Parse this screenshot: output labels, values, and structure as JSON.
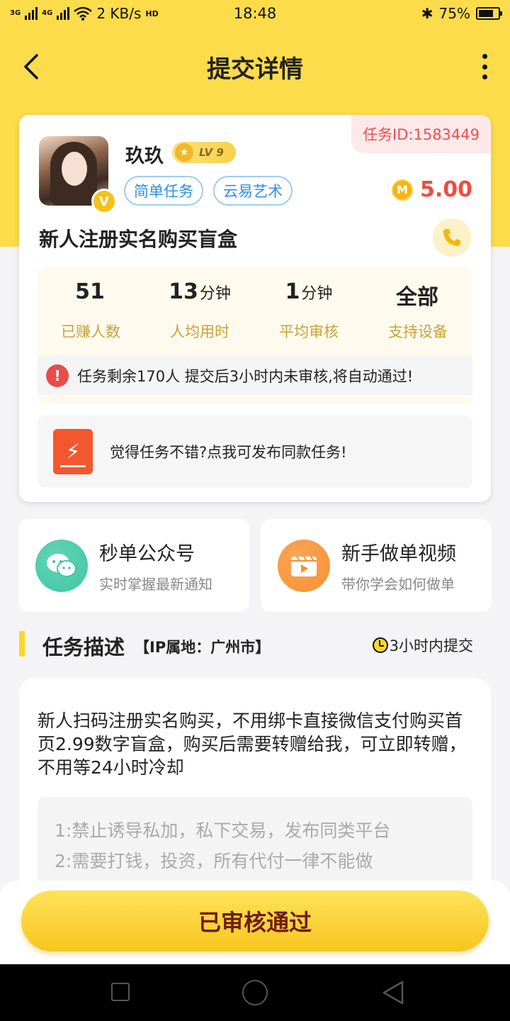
{
  "status_bar": {
    "net1": "3G",
    "net2": "4G",
    "speed": "2 KB/s",
    "hd": "HD",
    "time": "18:48",
    "bluetooth": "✱",
    "battery": "75%",
    "battery_level": 0.75
  },
  "header": {
    "title": "提交详情",
    "back_icon": "chevron-left-icon",
    "more_icon": "more-vertical-icon"
  },
  "task": {
    "id_label": "任务ID:1583449",
    "user_name": "玖玖",
    "vip_badge": "V",
    "level": "LV 9",
    "tags": [
      "简单任务",
      "云易艺术"
    ],
    "coin_symbol": "M",
    "reward": "5.00",
    "title": "新人注册实名购买盲盒",
    "stats": [
      {
        "value": "51",
        "unit": "",
        "label": "已赚人数"
      },
      {
        "value": "13",
        "unit": "分钟",
        "label": "人均用时"
      },
      {
        "value": "1",
        "unit": "分钟",
        "label": "平均审核"
      },
      {
        "value": "全部",
        "unit": "",
        "label": "支持设备"
      }
    ],
    "alert_mark": "!",
    "notice": "任务剩余170人  提交后3小时内未审核,将自动通过!",
    "publish_text": "觉得任务不错?点我可发布同款任务!"
  },
  "cards": [
    {
      "title": "秒单公众号",
      "subtitle": "实时掌握最新通知",
      "icon": "wechat-icon",
      "color": "#3ec7a3"
    },
    {
      "title": "新手做单视频",
      "subtitle": "带你学会如何做单",
      "icon": "video-icon",
      "color": "#f7902f"
    }
  ],
  "section": {
    "title": "任务描述",
    "ip": "【IP属地：广州市】",
    "time_limit": "3小时内提交"
  },
  "description": {
    "text": "新人扫码注册实名购买，不用绑卡直接微信支付购买首页2.99数字盲盒，购买后需要转赠给我，可立即转赠，不用等24小时冷却",
    "rules": [
      "1:禁止诱导私加，私下交易，发布同类平台",
      "2:需要打钱，投资，所有代付一律不能做"
    ]
  },
  "bottom": {
    "button_label": "已审核通过"
  },
  "colors": {
    "brand_yellow": "#fcdc4a",
    "reward_red": "#f04b3f",
    "tag_blue": "#2f8fe0"
  }
}
